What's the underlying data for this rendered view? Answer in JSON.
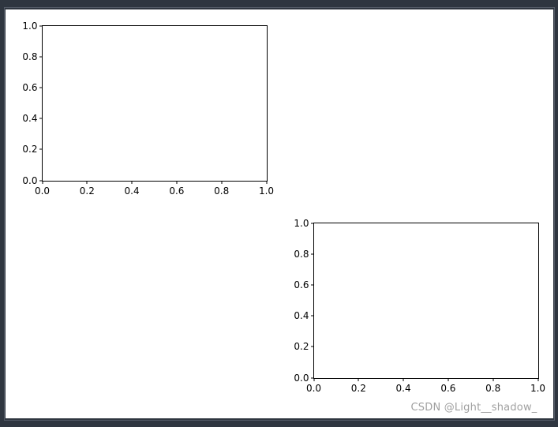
{
  "chart_data": [
    {
      "type": "line",
      "position": "top-left",
      "categories": [],
      "values": [],
      "series": [],
      "title": "",
      "xlabel": "",
      "ylabel": "",
      "xlim": [
        0.0,
        1.0
      ],
      "ylim": [
        0.0,
        1.0
      ],
      "xticks": [
        0.0,
        0.2,
        0.4,
        0.6,
        0.8,
        1.0
      ],
      "yticks": [
        0.0,
        0.2,
        0.4,
        0.6,
        0.8,
        1.0
      ]
    },
    {
      "type": "line",
      "position": "bottom-right",
      "categories": [],
      "values": [],
      "series": [],
      "title": "",
      "xlabel": "",
      "ylabel": "",
      "xlim": [
        0.0,
        1.0
      ],
      "ylim": [
        0.0,
        1.0
      ],
      "xticks": [
        0.0,
        0.2,
        0.4,
        0.6,
        0.8,
        1.0
      ],
      "yticks": [
        0.0,
        0.2,
        0.4,
        0.6,
        0.8,
        1.0
      ]
    }
  ],
  "tick_labels": {
    "ax1_y": [
      "0.0",
      "0.2",
      "0.4",
      "0.6",
      "0.8",
      "1.0"
    ],
    "ax1_x": [
      "0.0",
      "0.2",
      "0.4",
      "0.6",
      "0.8",
      "1.0"
    ],
    "ax2_y": [
      "0.0",
      "0.2",
      "0.4",
      "0.6",
      "0.8",
      "1.0"
    ],
    "ax2_x": [
      "0.0",
      "0.2",
      "0.4",
      "0.6",
      "0.8",
      "1.0"
    ]
  },
  "watermark": "CSDN @Light__shadow_"
}
